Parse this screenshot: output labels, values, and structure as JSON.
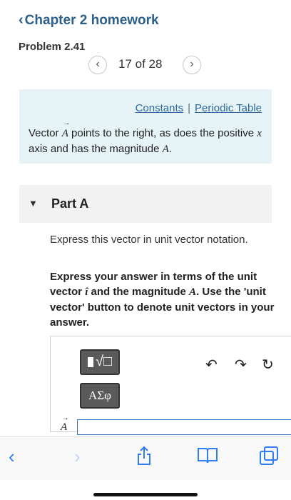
{
  "nav": {
    "back_label": "Chapter 2 homework"
  },
  "problem": {
    "title": "Problem 2.41",
    "pager_text": "17 of 28"
  },
  "intro": {
    "links": [
      "Constants",
      "Periodic Table"
    ],
    "separator": "|",
    "text_before": "Vector ",
    "vector_symbol": "A",
    "text_middle": " points to the right, as does the positive ",
    "axis_symbol": "x",
    "text_after": " axis and has the magnitude ",
    "magnitude_symbol": "A",
    "period": "."
  },
  "part": {
    "label": "Part A",
    "instruction": "Express this vector in unit vector notation.",
    "emphasis_1": "Express your answer in terms of the unit vector ",
    "unit_vector_symbol": "î",
    "emphasis_2": " and the magnitude ",
    "magnitude_symbol": "A",
    "emphasis_3": ". Use the 'unit vector' button to denote unit vectors in your answer."
  },
  "answer": {
    "template_button_label": "√□",
    "symbol_button_label": "ΑΣφ",
    "prefix": "A",
    "value": ""
  },
  "icons": {
    "undo": "undo-icon",
    "redo": "redo-icon",
    "reset": "reset-icon",
    "browser_back": "chevron-left-icon",
    "browser_forward": "chevron-right-icon",
    "share": "share-icon",
    "bookmarks": "book-icon",
    "tabs": "tabs-icon"
  },
  "colors": {
    "link": "#2c6aa0",
    "intro_background": "#e6f3f7",
    "accent_ios": "#2f7cf6"
  }
}
